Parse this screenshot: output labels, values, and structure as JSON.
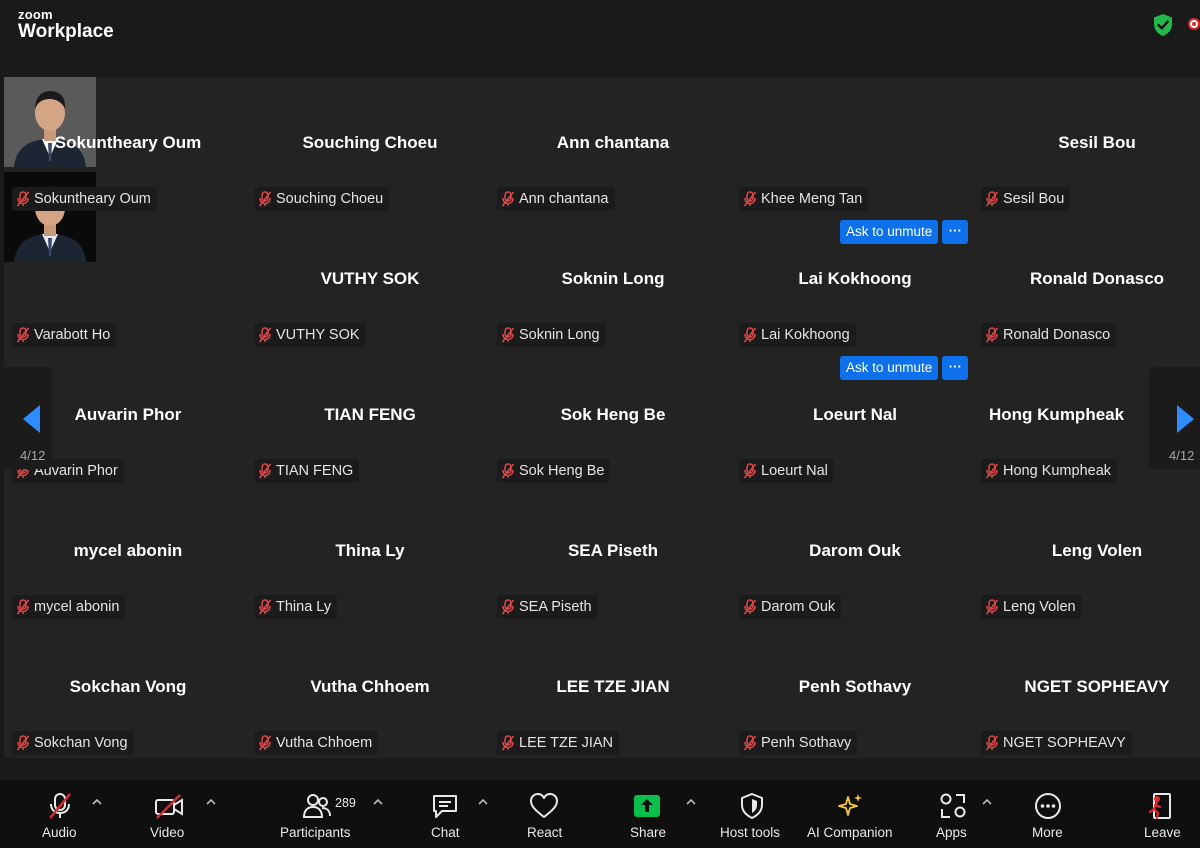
{
  "app": {
    "brand_small": "zoom",
    "brand_large": "Workplace"
  },
  "gallery": {
    "page_indicator": "4/12",
    "ask_to_unmute_label": "Ask to unmute",
    "more_label": "···",
    "tiles": [
      {
        "big": "Sokuntheary Oum",
        "label": "Sokuntheary Oum"
      },
      {
        "big": "Souching Choeu",
        "label": "Souching Choeu"
      },
      {
        "big": "Ann chantana",
        "label": "Ann chantana"
      },
      {
        "big": "",
        "label": "Khee Meng Tan"
      },
      {
        "big": "Sesil Bou",
        "label": "Sesil Bou"
      },
      {
        "big": "",
        "label": "Varabott Ho"
      },
      {
        "big": "VUTHY SOK",
        "label": "VUTHY SOK"
      },
      {
        "big": "Soknin Long",
        "label": "Soknin Long"
      },
      {
        "big": "Lai Kokhoong",
        "label": "Lai Kokhoong"
      },
      {
        "big": "Ronald Donasco",
        "label": "Ronald Donasco"
      },
      {
        "big": "Auvarin Phor",
        "label": "Auvarin Phor"
      },
      {
        "big": "TIAN FENG",
        "label": "TIAN FENG"
      },
      {
        "big": "Sok Heng Be",
        "label": "Sok Heng Be"
      },
      {
        "big": "Loeurt Nal",
        "label": "Loeurt Nal"
      },
      {
        "big": "Hong Kumpheak",
        "label": "Hong Kumpheak"
      },
      {
        "big": "mycel abonin",
        "label": "mycel abonin"
      },
      {
        "big": "Thina Ly",
        "label": "Thina Ly"
      },
      {
        "big": "SEA Piseth",
        "label": "SEA Piseth"
      },
      {
        "big": "Darom Ouk",
        "label": "Darom Ouk"
      },
      {
        "big": "Leng Volen",
        "label": "Leng Volen"
      },
      {
        "big": "Sokchan Vong",
        "label": "Sokchan Vong"
      },
      {
        "big": "Vutha Chhoem",
        "label": "Vutha Chhoem"
      },
      {
        "big": "LEE TZE JIAN",
        "label": "LEE TZE JIAN"
      },
      {
        "big": "Penh Sothavy",
        "label": "Penh Sothavy"
      },
      {
        "big": "NGET SOPHEAVY",
        "label": "NGET SOPHEAVY"
      }
    ]
  },
  "toolbar": {
    "audio": "Audio",
    "video": "Video",
    "participants": "Participants",
    "participants_count": "289",
    "chat": "Chat",
    "react": "React",
    "share": "Share",
    "host_tools": "Host tools",
    "ai_companion": "AI Companion",
    "apps": "Apps",
    "more": "More",
    "leave": "Leave"
  },
  "colors": {
    "accent": "#0e71eb",
    "share_green": "#0bbf4c",
    "mute_red": "#e02828",
    "nav_arrow": "#2d8cff",
    "ai_gold": "#f5c542"
  }
}
